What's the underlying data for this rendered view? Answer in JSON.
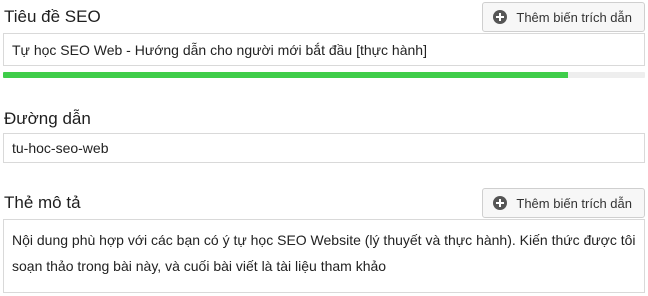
{
  "seo_title": {
    "label": "Tiêu đề SEO",
    "insert_button": "Thêm biến trích dẫn",
    "value": "Tự học SEO Web - Hướng dẫn cho người mới bắt đầu [thực hành]",
    "progress_fraction": 0.88,
    "progress_color": "#3fcd4a"
  },
  "slug": {
    "label": "Đường dẫn",
    "value": "tu-hoc-seo-web"
  },
  "meta_description": {
    "label": "Thẻ mô tả",
    "insert_button": "Thêm biến trích dẫn",
    "value": "Nội dung phù hợp với các bạn có ý tự học SEO Website (lý thuyết và thực hành). Kiến thức được tôi soạn thảo trong bài này, và cuối bài viết là tài liệu tham khảo"
  }
}
